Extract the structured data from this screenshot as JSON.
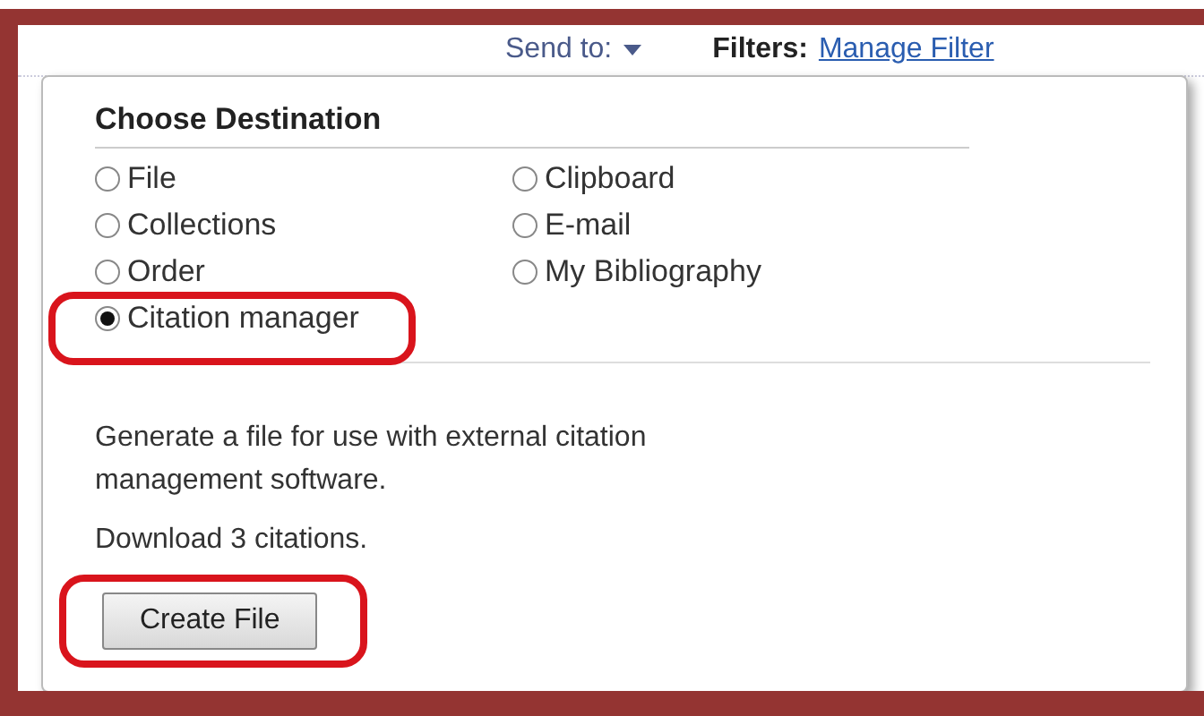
{
  "toolbar": {
    "send_to": "Send to:",
    "filters_label": "Filters:",
    "filters_link": "Manage Filter"
  },
  "popup": {
    "title": "Choose Destination",
    "options": [
      {
        "label": "File",
        "selected": false,
        "highlighted": false
      },
      {
        "label": "Clipboard",
        "selected": false,
        "highlighted": false
      },
      {
        "label": "Collections",
        "selected": false,
        "highlighted": false
      },
      {
        "label": "E-mail",
        "selected": false,
        "highlighted": false
      },
      {
        "label": "Order",
        "selected": false,
        "highlighted": false
      },
      {
        "label": "My Bibliography",
        "selected": false,
        "highlighted": false
      },
      {
        "label": "Citation manager",
        "selected": true,
        "highlighted": true
      }
    ],
    "description": "Generate a file for use with external citation management software.",
    "count_text": "Download 3 citations.",
    "button": {
      "label": "Create File",
      "highlighted": true
    }
  }
}
